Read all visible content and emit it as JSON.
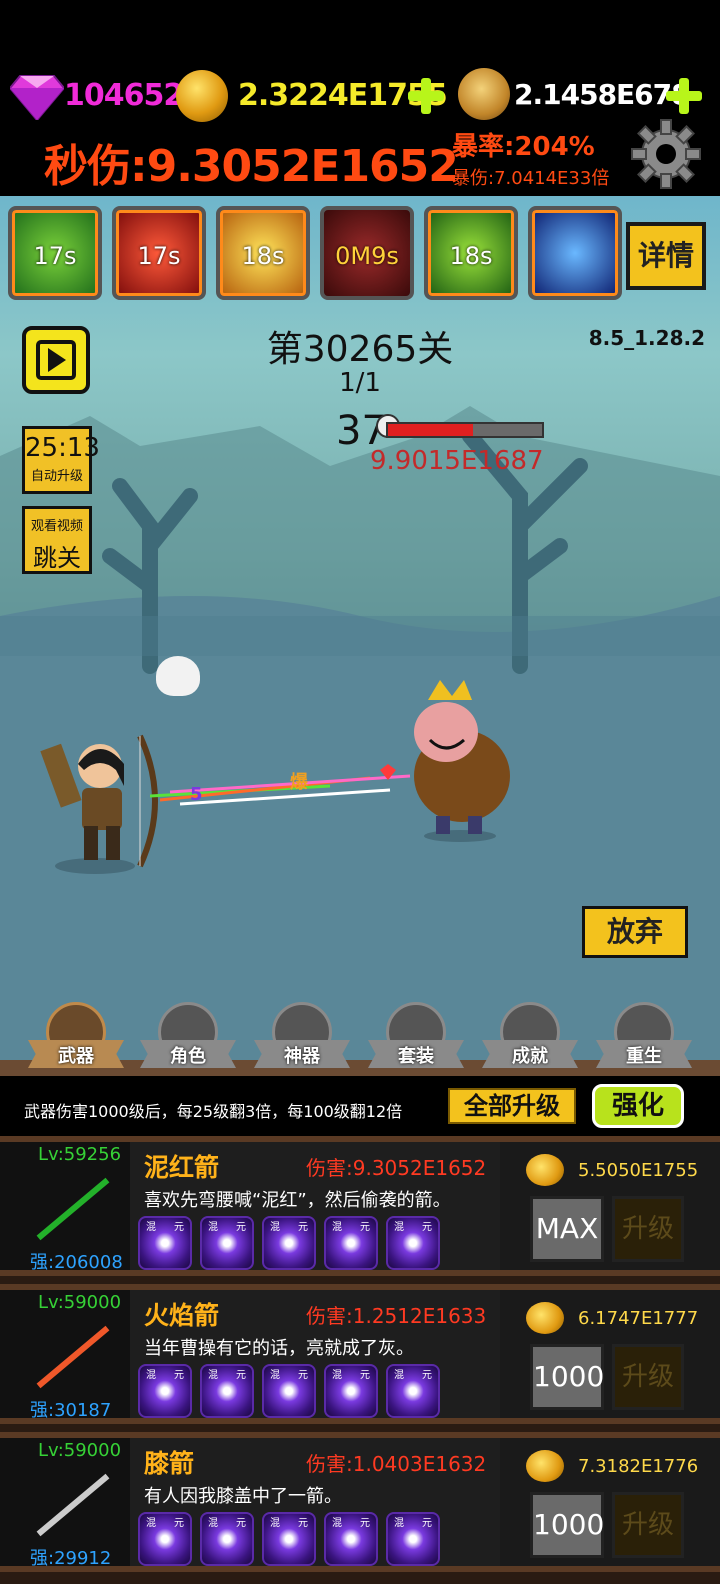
{
  "header": {
    "gems": "104652",
    "gold": "2.3224E1755",
    "skulls": "2.1458E678",
    "dps": "秒伤:9.3052E1652",
    "crit_rate": "暴率:204%",
    "crit_damage": "暴伤:7.0414E33倍",
    "colors": {
      "gems": "#f02bd8",
      "gold": "#f5ea2a",
      "skulls": "#ffffff",
      "dps": "#ff4a12"
    }
  },
  "skills": [
    {
      "icon": "green-arrow-skill-icon",
      "timer": "17s"
    },
    {
      "icon": "red-fire-skill-icon",
      "timer": "17s"
    },
    {
      "icon": "yellow-burst-skill-icon",
      "timer": "18s"
    },
    {
      "icon": "dark-red-figure-skill-icon",
      "timer": "0M9s"
    },
    {
      "icon": "green-bow-skill-icon",
      "timer": "18s"
    },
    {
      "icon": "blue-lightning-skill-icon",
      "timer": ""
    }
  ],
  "detail_label": "详情",
  "stage": {
    "title": "第30265关",
    "version": "8.5_1.28.2",
    "wave": "1/1",
    "enemy_count": "37",
    "enemy_hp": "9.9015E1687",
    "hp_fraction": 0.55
  },
  "auto_upgrade": {
    "time": "25:13",
    "label": "自动升级"
  },
  "skip": {
    "top": "观看视频",
    "label": "跳关"
  },
  "abandon_label": "放弃",
  "nav": [
    {
      "label": "武器",
      "icon": "axe-icon",
      "active": true
    },
    {
      "label": "角色",
      "icon": "character-icon",
      "active": false
    },
    {
      "label": "神器",
      "icon": "artifact-icon",
      "active": false
    },
    {
      "label": "套装",
      "icon": "helmet-icon",
      "active": false
    },
    {
      "label": "成就",
      "icon": "book-icon",
      "active": false
    },
    {
      "label": "重生",
      "icon": "rebirth-flame-icon",
      "active": false
    }
  ],
  "upgrade_bar": {
    "tip": "武器伤害1000级后，每25级翻3倍，每100级翻12倍",
    "upgrade_all": "全部升级",
    "enhance": "强化"
  },
  "weapons": [
    {
      "level": "Lv:59256",
      "name": "泥红箭",
      "damage": "伤害:9.3052E1652",
      "desc": "喜欢先弯腰喊“泥红”，然后偷袭的箭。",
      "strength": "强:206008",
      "cost": "5.5050E1755",
      "level_box": "MAX",
      "upgrade": "升级",
      "arrow_color": "#23b12a"
    },
    {
      "level": "Lv:59000",
      "name": "火焰箭",
      "damage": "伤害:1.2512E1633",
      "desc": "当年曹操有它的话，亮就成了灰。",
      "strength": "强:30187",
      "cost": "6.1747E1777",
      "level_box": "1000",
      "upgrade": "升级",
      "arrow_color": "#f0582a"
    },
    {
      "level": "Lv:59000",
      "name": "膝箭",
      "damage": "伤害:1.0403E1632",
      "desc": "有人因我膝盖中了一箭。",
      "strength": "强:29912",
      "cost": "7.3182E1776",
      "level_box": "1000",
      "upgrade": "升级",
      "arrow_color": "#cccccc"
    }
  ],
  "rune_tags": {
    "left": "混",
    "right": "元"
  }
}
